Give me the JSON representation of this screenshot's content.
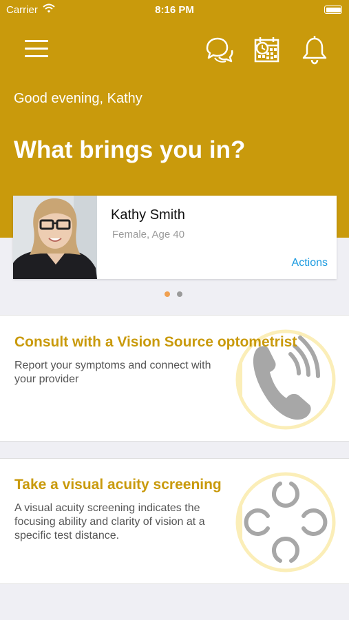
{
  "status_bar": {
    "carrier": "Carrier",
    "time": "8:16 PM"
  },
  "header": {
    "greeting": "Good evening, Kathy",
    "question": "What brings you in?",
    "icons": [
      "menu-icon",
      "chat-icon",
      "calendar-icon",
      "bell-icon"
    ]
  },
  "profile": {
    "name": "Kathy Smith",
    "details": "Female, Age 40",
    "actions_label": "Actions",
    "page_index": 1,
    "page_count": 2
  },
  "options": [
    {
      "title": "Consult with a Vision Source optometrist",
      "description": "Report your symptoms and connect with your provider",
      "icon": "phone-icon"
    },
    {
      "title": "Take a visual acuity screening",
      "description": "A visual acuity screening indicates the focusing ability and clarity of vision at a specific test distance.",
      "icon": "landolt-c-icon"
    }
  ],
  "colors": {
    "brand_gold": "#c99a0c",
    "link_blue": "#1a9ae0",
    "page_background": "#efeff4",
    "pager_active": "#f0a050",
    "pager_inactive": "#9a9a9a",
    "graphic_fill": "#fbeeb8"
  }
}
